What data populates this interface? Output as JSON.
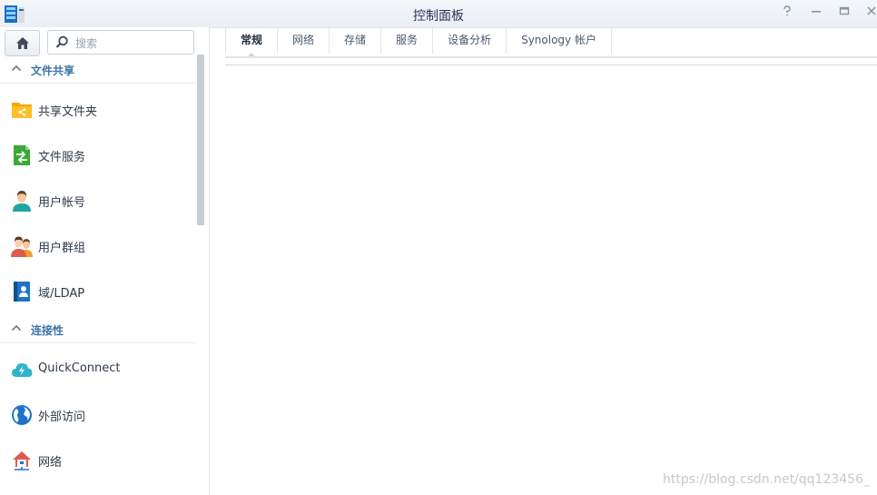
{
  "window": {
    "title": "控制面板",
    "controls": [
      "help-icon",
      "minimize-icon",
      "maximize-icon",
      "close-icon"
    ]
  },
  "search": {
    "placeholder": "搜索"
  },
  "sidebar": {
    "sections": [
      {
        "label": "文件共享",
        "items": [
          {
            "label": "共享文件夹",
            "icon": "shared-folder-icon"
          },
          {
            "label": "文件服务",
            "icon": "file-services-icon"
          },
          {
            "label": "用户帐号",
            "icon": "user-icon"
          },
          {
            "label": "用户群组",
            "icon": "group-icon"
          },
          {
            "label": "域/LDAP",
            "icon": "domain-ldap-icon"
          }
        ]
      },
      {
        "label": "连接性",
        "items": [
          {
            "label": "QuickConnect",
            "icon": "quickconnect-icon"
          },
          {
            "label": "外部访问",
            "icon": "external-access-icon"
          },
          {
            "label": "网络",
            "icon": "network-icon"
          }
        ]
      }
    ]
  },
  "tabs": [
    {
      "label": "常规",
      "active": true
    },
    {
      "label": "网络"
    },
    {
      "label": "存储"
    },
    {
      "label": "服务"
    },
    {
      "label": "设备分析"
    },
    {
      "label": "Synology 帐户"
    }
  ],
  "watermark": "https://blog.csdn.net/qq123456_",
  "colors": {
    "accent": "#3b74a8",
    "folder": "#f6a800",
    "file_service": "#3aa935",
    "user": "#1ea7a0",
    "domain": "#1e73c8",
    "quickconnect": "#2fb5c9",
    "network": "#e05b4b"
  }
}
